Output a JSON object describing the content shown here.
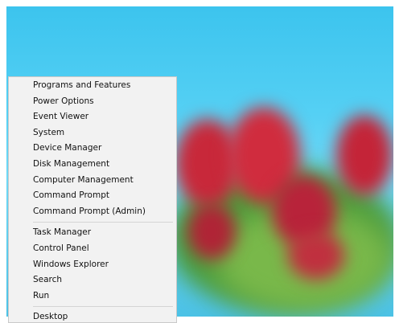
{
  "menu": {
    "groups": [
      [
        "Programs and Features",
        "Power Options",
        "Event Viewer",
        "System",
        "Device Manager",
        "Disk Management",
        "Computer Management",
        "Command Prompt",
        "Command Prompt (Admin)"
      ],
      [
        "Task Manager",
        "Control Panel",
        "Windows Explorer",
        "Search",
        "Run"
      ],
      [
        "Desktop"
      ]
    ]
  },
  "colors": {
    "menu_bg": "#f2f2f2",
    "menu_border": "#c9c9c9",
    "sky": "#55d0f4",
    "tulip_red": "#c8283a",
    "foliage": "#4a9a3a"
  }
}
